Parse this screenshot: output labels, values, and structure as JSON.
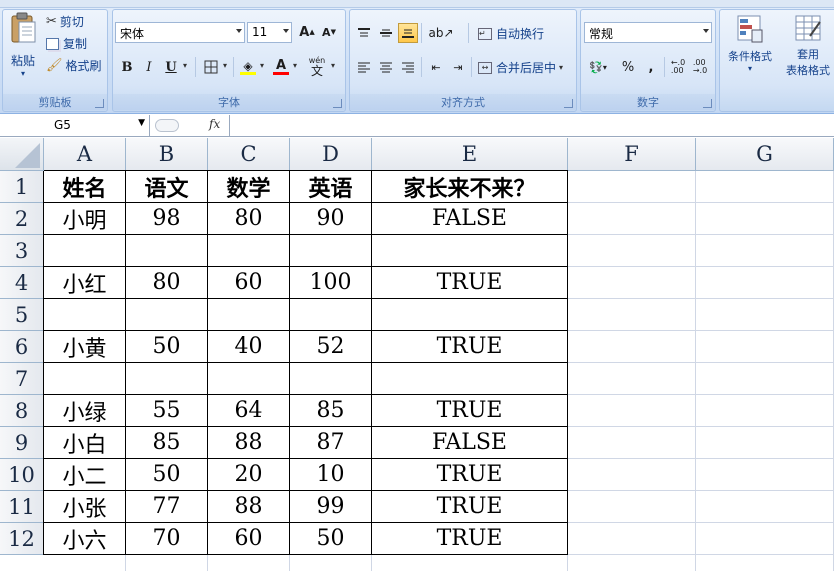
{
  "ribbon": {
    "clipboard": {
      "group_label": "剪贴板",
      "paste": "粘贴",
      "cut": "剪切",
      "copy": "复制",
      "format_painter": "格式刷"
    },
    "font": {
      "group_label": "字体",
      "font_name": "宋体",
      "font_size": "11",
      "grow": "A",
      "shrink": "A",
      "bold": "B",
      "italic": "I",
      "underline": "U",
      "font_color_glyph": "A",
      "phonetic_glyph": "wén"
    },
    "alignment": {
      "group_label": "对齐方式",
      "wrap_text": "自动换行",
      "merge_center": "合并后居中"
    },
    "number": {
      "group_label": "数字",
      "format": "常规",
      "percent": "%",
      "comma": ","
    },
    "styles": {
      "conditional_format": "条件格式",
      "table_format_line1": "套用",
      "table_format_line2": "表格格式"
    }
  },
  "formula_bar": {
    "name_box": "G5",
    "fx": "fx",
    "formula": ""
  },
  "columns": [
    "A",
    "B",
    "C",
    "D",
    "E",
    "F",
    "G"
  ],
  "rows": [
    "1",
    "2",
    "3",
    "4",
    "5",
    "6",
    "7",
    "8",
    "9",
    "10",
    "11",
    "12"
  ],
  "table": {
    "headers": [
      "姓名",
      "语文",
      "数学",
      "英语",
      "家长来不来？"
    ],
    "data": [
      [
        "小明",
        "98",
        "80",
        "90",
        "FALSE"
      ],
      [
        "",
        "",
        "",
        "",
        ""
      ],
      [
        "小红",
        "80",
        "60",
        "100",
        "TRUE"
      ],
      [
        "",
        "",
        "",
        "",
        ""
      ],
      [
        "小黄",
        "50",
        "40",
        "52",
        "TRUE"
      ],
      [
        "",
        "",
        "",
        "",
        ""
      ],
      [
        "小绿",
        "55",
        "64",
        "85",
        "TRUE"
      ],
      [
        "小白",
        "85",
        "88",
        "87",
        "FALSE"
      ],
      [
        "小二",
        "50",
        "20",
        "10",
        "TRUE"
      ],
      [
        "小张",
        "77",
        "88",
        "99",
        "TRUE"
      ],
      [
        "小六",
        "70",
        "60",
        "50",
        "TRUE"
      ]
    ]
  }
}
